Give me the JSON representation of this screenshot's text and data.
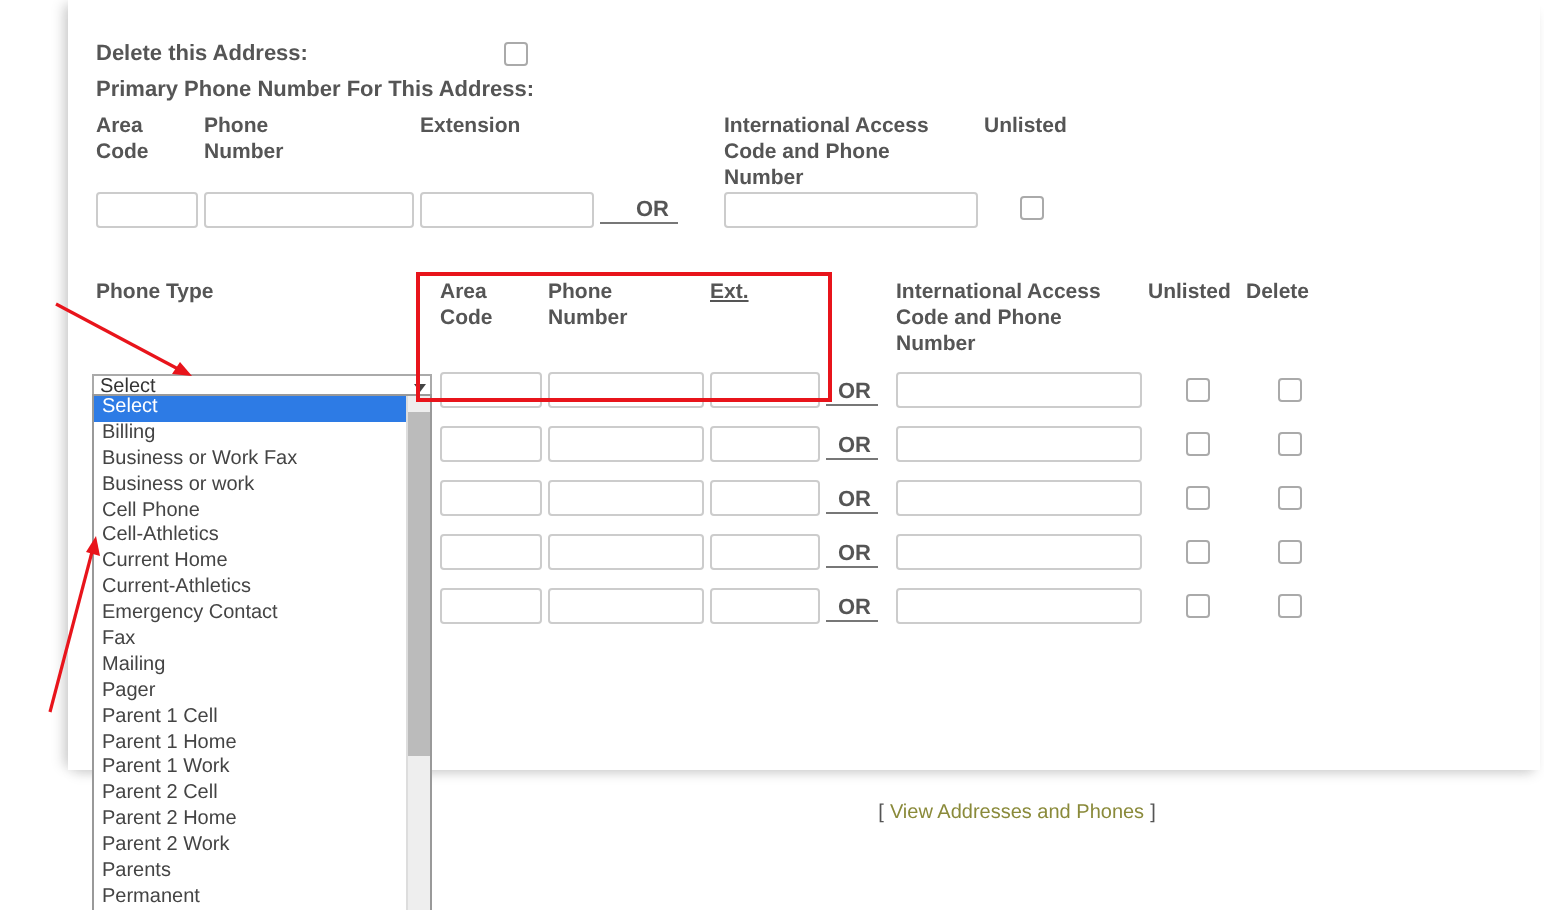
{
  "delete_address": {
    "label": "Delete this Address:",
    "checked": false
  },
  "primary_phone": {
    "title": "Primary Phone Number For This Address:",
    "columns": [
      "Area Code",
      "Phone Number",
      "Extension",
      "",
      "International Access Code and Phone Number",
      "Unlisted"
    ],
    "or_label": "OR",
    "unlisted": false
  },
  "phone_table": {
    "columns": [
      "Phone Type",
      "Area Code",
      "Phone Number",
      "Ext.",
      "",
      "International Access Code and Phone Number",
      "Unlisted",
      "Delete"
    ],
    "rows": [
      {
        "phone_type": "Select",
        "or_label": "OR",
        "unlisted": false,
        "delete": false
      },
      {
        "or_label": "OR",
        "unlisted": false,
        "delete": false
      },
      {
        "or_label": "OR",
        "unlisted": false,
        "delete": false
      },
      {
        "or_label": "OR",
        "unlisted": false,
        "delete": false
      },
      {
        "or_label": "OR",
        "unlisted": false,
        "delete": false
      }
    ]
  },
  "dropdown": {
    "options": [
      {
        "label": "Select",
        "selected": true
      },
      {
        "label": "Billing",
        "selected": false
      },
      {
        "label": "Business or Work Fax",
        "selected": false
      },
      {
        "label": "Business or work",
        "selected": false
      },
      {
        "label": "Cell Phone",
        "selected": false
      },
      {
        "label": "Cell-Athletics",
        "selected": false
      },
      {
        "label": "Current Home",
        "selected": false
      },
      {
        "label": "Current-Athletics",
        "selected": false
      },
      {
        "label": "Emergency Contact",
        "selected": false
      },
      {
        "label": "Fax",
        "selected": false
      },
      {
        "label": "Mailing",
        "selected": false
      },
      {
        "label": "Pager",
        "selected": false
      },
      {
        "label": "Parent 1 Cell",
        "selected": false
      },
      {
        "label": "Parent 1 Home",
        "selected": false
      },
      {
        "label": "Parent 1 Work",
        "selected": false
      },
      {
        "label": "Parent 2 Cell",
        "selected": false
      },
      {
        "label": "Parent 2 Home",
        "selected": false
      },
      {
        "label": "Parent 2 Work",
        "selected": false
      },
      {
        "label": "Parents",
        "selected": false
      },
      {
        "label": "Permanent",
        "selected": false
      }
    ]
  },
  "footer": {
    "open_bracket": "[",
    "link": "View Addresses and Phones",
    "close_bracket": "]"
  }
}
